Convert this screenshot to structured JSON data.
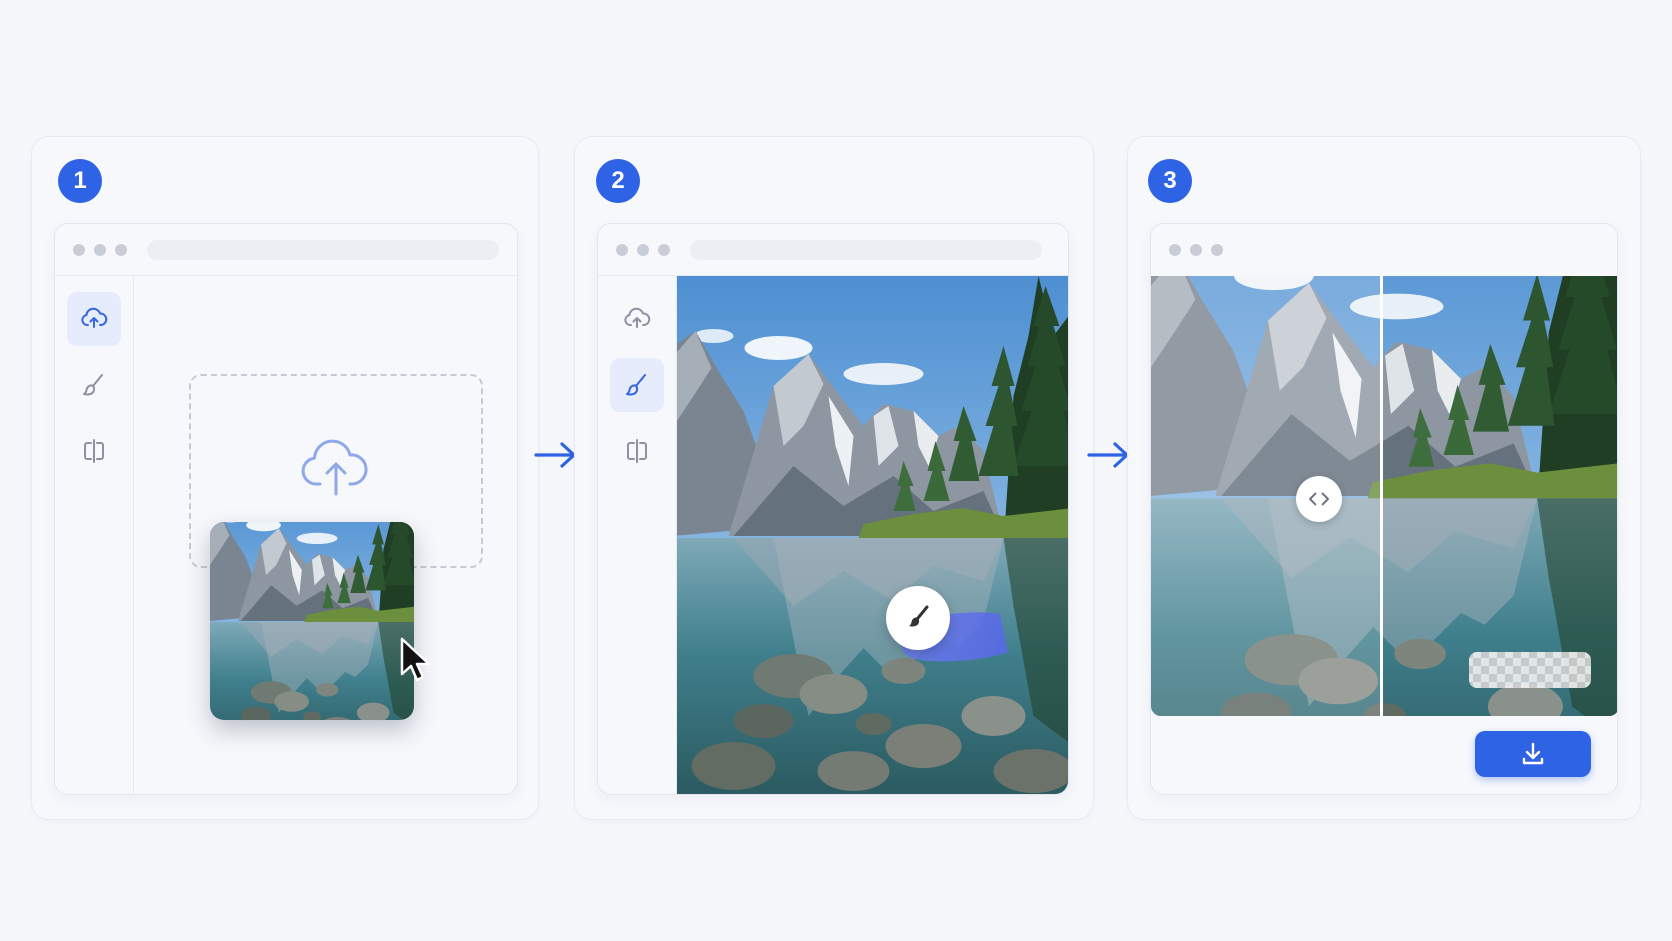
{
  "steps": [
    {
      "number": "1",
      "active_tool": "upload"
    },
    {
      "number": "2",
      "active_tool": "brush"
    },
    {
      "number": "3",
      "active_tool": "none"
    }
  ],
  "sidebar": {
    "tools": [
      {
        "name": "upload-cloud-icon"
      },
      {
        "name": "brush-icon"
      },
      {
        "name": "compare-split-icon"
      }
    ]
  },
  "icons": {
    "upload": "upload-cloud-icon",
    "cursor": "mouse-pointer-icon",
    "arrow": "arrow-right-icon",
    "brush": "brush-icon",
    "compare_handle": "chevrons-left-right-icon",
    "download": "download-icon"
  },
  "colors": {
    "accent": "#2f63e5",
    "brush_stroke": "#6477ee",
    "background": "#f5f7fb",
    "panel": "#f7f8fc",
    "muted_icon": "#8c92a3"
  }
}
